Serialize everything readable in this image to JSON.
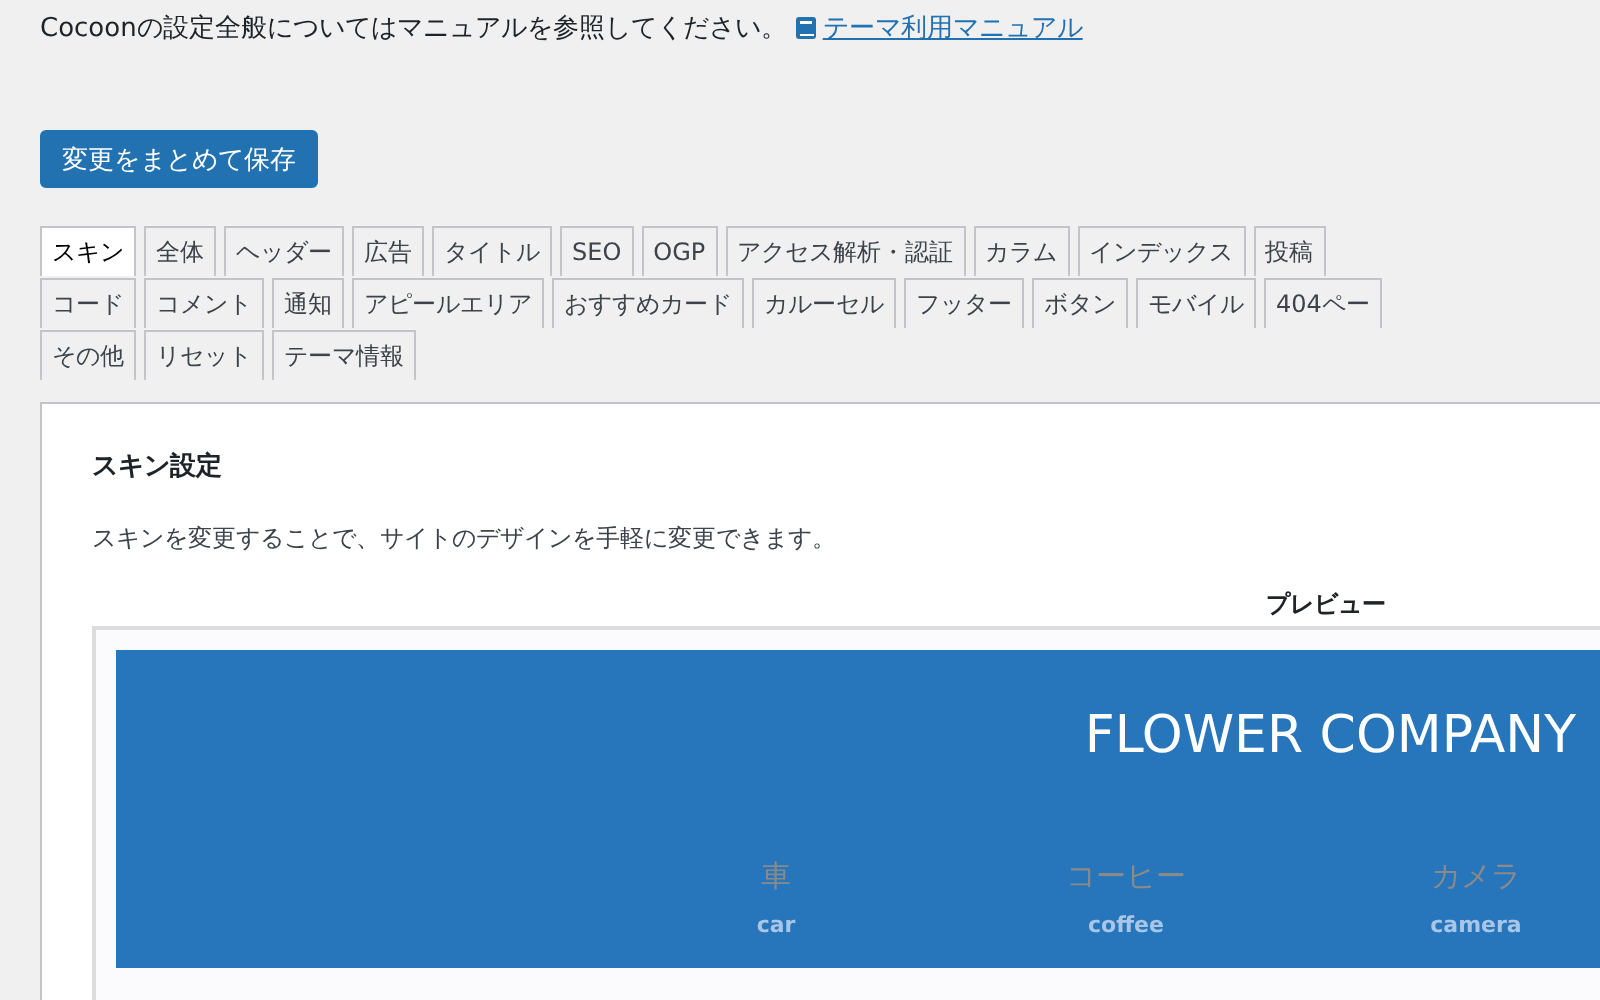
{
  "notice": {
    "text": "Cocoonの設定全般についてはマニュアルを参照してください。",
    "link": "テーマ利用マニュアル"
  },
  "save_button": "変更をまとめて保存",
  "tab_rows": [
    [
      {
        "label": "スキン",
        "selected": true
      },
      {
        "label": "全体",
        "selected": false
      },
      {
        "label": "ヘッダー",
        "selected": false
      },
      {
        "label": "広告",
        "selected": false
      },
      {
        "label": "タイトル",
        "selected": false
      },
      {
        "label": "SEO",
        "selected": false
      },
      {
        "label": "OGP",
        "selected": false
      },
      {
        "label": "アクセス解析・認証",
        "selected": false
      },
      {
        "label": "カラム",
        "selected": false
      },
      {
        "label": "インデックス",
        "selected": false
      },
      {
        "label": "投稿",
        "selected": false
      }
    ],
    [
      {
        "label": "コード",
        "selected": false
      },
      {
        "label": "コメント",
        "selected": false
      },
      {
        "label": "通知",
        "selected": false
      },
      {
        "label": "アピールエリア",
        "selected": false
      },
      {
        "label": "おすすめカード",
        "selected": false
      },
      {
        "label": "カルーセル",
        "selected": false
      },
      {
        "label": "フッター",
        "selected": false
      },
      {
        "label": "ボタン",
        "selected": false
      },
      {
        "label": "モバイル",
        "selected": false
      },
      {
        "label": "404ペー",
        "selected": false
      }
    ],
    [
      {
        "label": "その他",
        "selected": false
      },
      {
        "label": "リセット",
        "selected": false
      },
      {
        "label": "テーマ情報",
        "selected": false
      }
    ]
  ],
  "panel": {
    "title": "スキン設定",
    "description": "スキンを変更することで、サイトのデザインを手軽に変更できます。",
    "preview_label": "プレビュー",
    "preview": {
      "site_title": "FLOWER COMPANY",
      "nav": [
        {
          "label": "車",
          "sublabel": "car"
        },
        {
          "label": "コーヒー",
          "sublabel": "coffee"
        },
        {
          "label": "カメラ",
          "sublabel": "camera"
        }
      ]
    }
  }
}
